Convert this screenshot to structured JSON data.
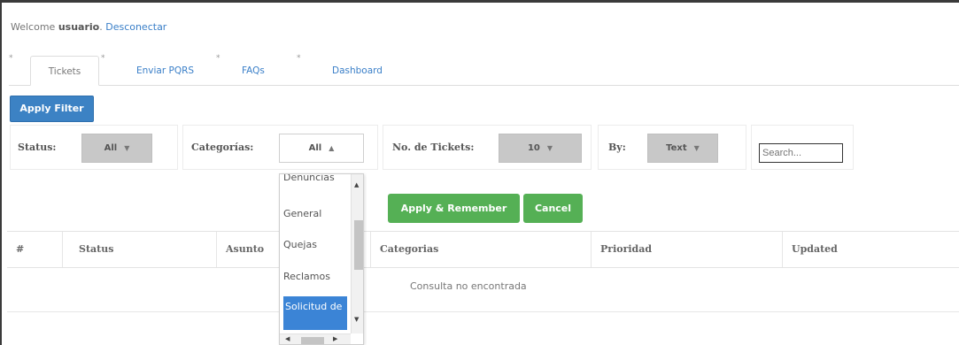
{
  "header": {
    "welcome_prefix": "Welcome",
    "username": "usuario",
    "logout_link": "Desconectar"
  },
  "tabs": [
    {
      "label": "Tickets",
      "active": true
    },
    {
      "label": "Enviar PQRS",
      "active": false
    },
    {
      "label": "FAQs",
      "active": false
    },
    {
      "label": "Dashboard",
      "active": false
    }
  ],
  "tab_marker": "*",
  "filters": {
    "apply_filter_label": "Apply Filter",
    "status_label": "Status:",
    "status_value": "All",
    "categorias_label": "Categorías:",
    "categorias_value": "All",
    "tickets_label": "No. de Tickets:",
    "tickets_value": "10",
    "by_label": "By:",
    "by_value": "Text",
    "search_placeholder": "Search...",
    "caret_down": "▼",
    "caret_up": "▲"
  },
  "categorias_options": [
    "Denuncias",
    "General",
    "Quejas",
    "Reclamos",
    "Solicitud de"
  ],
  "categorias_selected": "Solicitud de",
  "actions": {
    "apply_remember_label": "Apply & Remember",
    "cancel_label": "Cancel"
  },
  "table": {
    "columns": [
      "#",
      "Status",
      "Asunto",
      "Categorias",
      "Prioridad",
      "Updated"
    ],
    "empty_message": "Consulta no encontrada"
  },
  "scroll_arrows": {
    "up": "▲",
    "down": "▼",
    "left": "◀",
    "right": "▶"
  }
}
